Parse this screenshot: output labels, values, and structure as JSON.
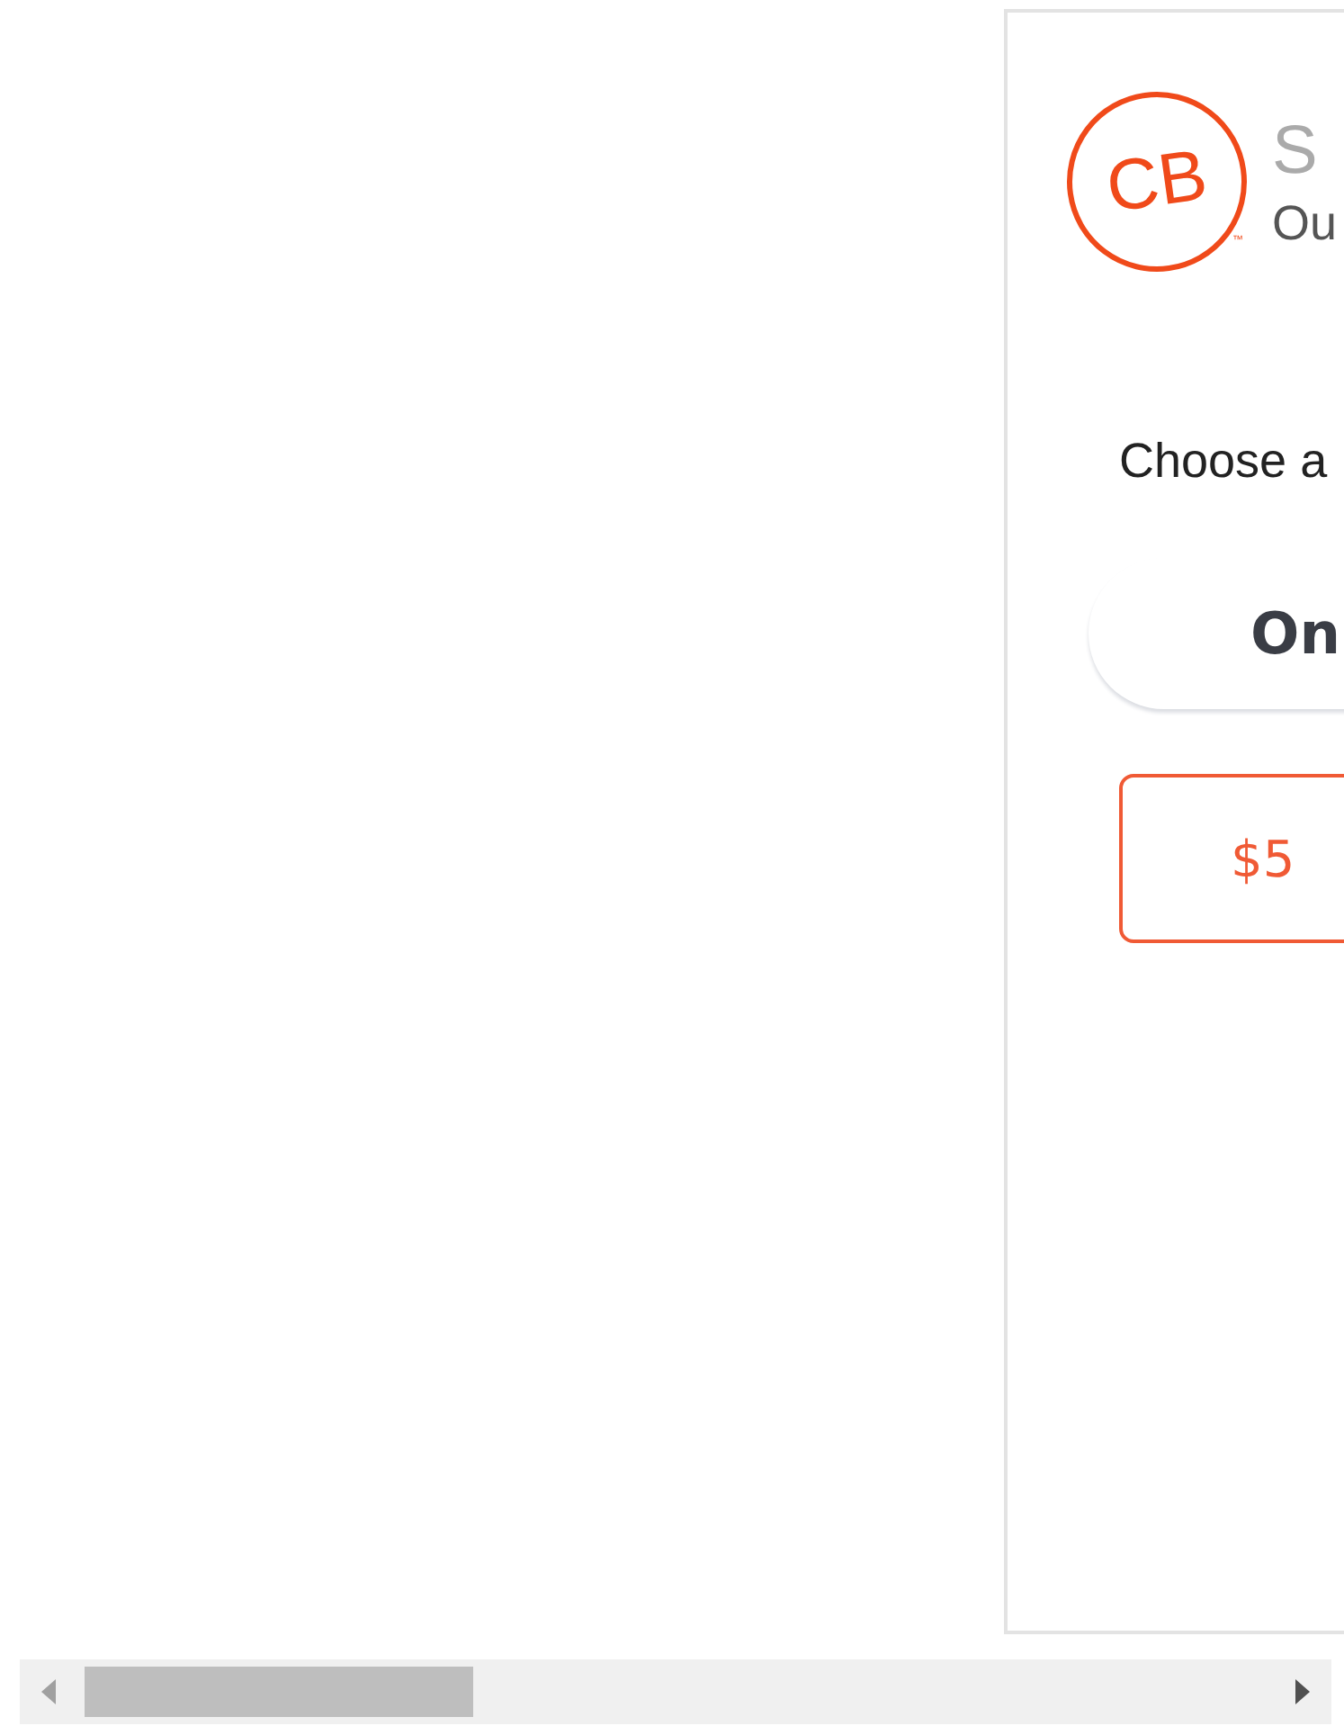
{
  "header": {
    "logo": {
      "text": "CB",
      "mark": "™"
    },
    "title": "S",
    "subtitle": "Ou"
  },
  "prompt": "Choose a",
  "tabs": [
    {
      "label": "On",
      "selected": true
    }
  ],
  "amounts": [
    {
      "label": "$5"
    }
  ]
}
